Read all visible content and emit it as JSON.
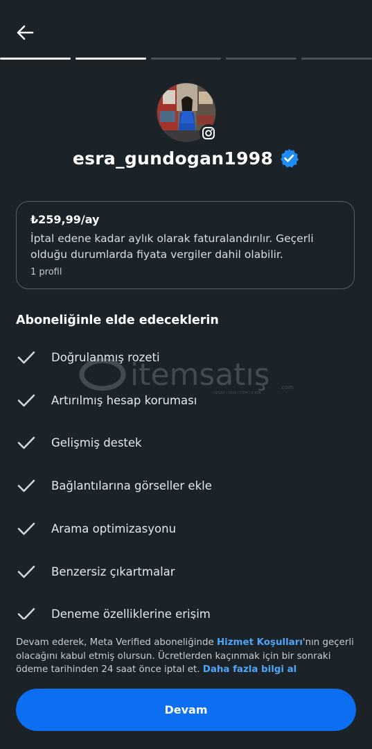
{
  "header": {
    "back_icon": "arrow-left-icon",
    "progress": {
      "total_steps": 5,
      "completed_steps": 2
    }
  },
  "profile": {
    "username": "esra_gundogan1998",
    "verified_icon": "verified-badge-icon",
    "platform_icon": "instagram-icon",
    "verified_color": "#1d8cf5"
  },
  "plan": {
    "price": "₺259,99/ay",
    "description": "İptal edene kadar aylık olarak faturalandırılır. Geçerli olduğu durumlarda fiyata vergiler dahil olabilir.",
    "profile_count": "1 profil"
  },
  "benefits": {
    "title": "Aboneliğinle elde edeceklerin",
    "check_icon": "checkmark-icon",
    "items": [
      "Doğrulanmış rozeti",
      "Artırılmış hesap koruması",
      "Gelişmiş destek",
      "Bağlantılarına görseller ekle",
      "Arama optimizasyonu",
      "Benzersiz çıkartmalar",
      "Deneme özelliklerine erişim"
    ]
  },
  "watermark": {
    "text": "itemsatış",
    "suffix": ".com",
    "tagline": "HESAP / SKIN / ITEM / E-PIN"
  },
  "legal": {
    "text_1": "Devam ederek, Meta Verified aboneliğinde ",
    "terms_link": "Hizmet Koşulları",
    "text_2": "'nın geçerli olacağını kabul etmiş olursun. Ücretlerden kaçınmak için bir sonraki ödeme tarihinden 24 saat önce iptal et. ",
    "more_link": "Daha fazla bilgi al"
  },
  "footer": {
    "continue_label": "Devam",
    "accent_color": "#0c6ef0"
  }
}
